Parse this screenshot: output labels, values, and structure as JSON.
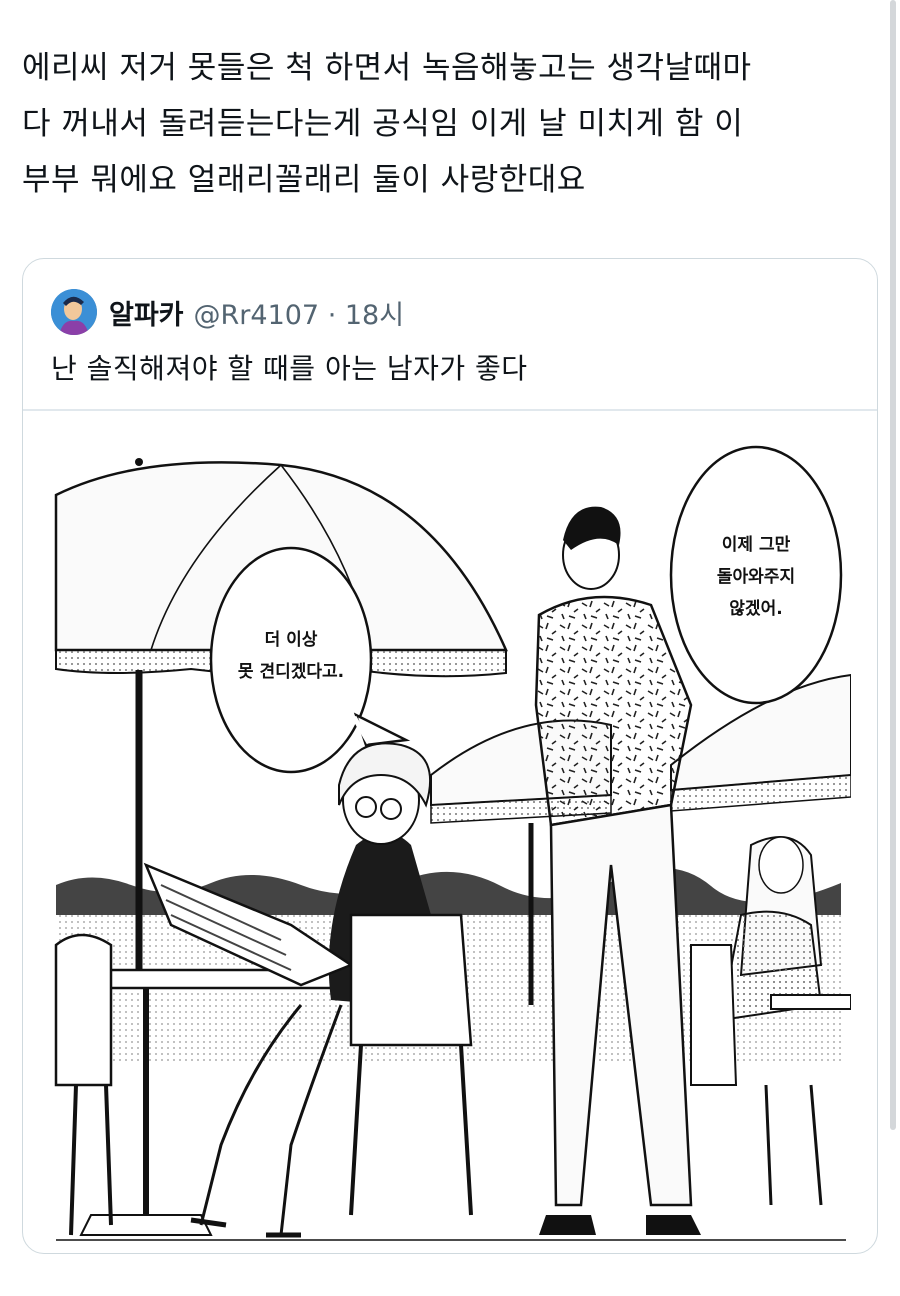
{
  "tweet": {
    "text": "에리씨 저거 못들은 척 하면서 녹음해놓고는 생각날때마\n다 꺼내서 돌려듣는다는게 공식임 이게 날 미치게 함 이\n부부 뭐에요 얼래리꼴래리 둘이 사랑한대요"
  },
  "quote": {
    "author_name": "알파카",
    "handle_time": "@Rr4107 · 18시",
    "text": "난 솔직해져야 할 때를 아는 남자가 좋다",
    "avatar_icon": "profile-avatar"
  },
  "comic": {
    "bubble_left": {
      "line1": "더 이상",
      "line2": "못 견디겠다고."
    },
    "bubble_right": {
      "line1": "이제 그만",
      "line2": "돌아와주지",
      "line3": "않겠어."
    }
  },
  "colors": {
    "border": "#cfd9de",
    "muted": "#536471",
    "text": "#0f1419"
  }
}
